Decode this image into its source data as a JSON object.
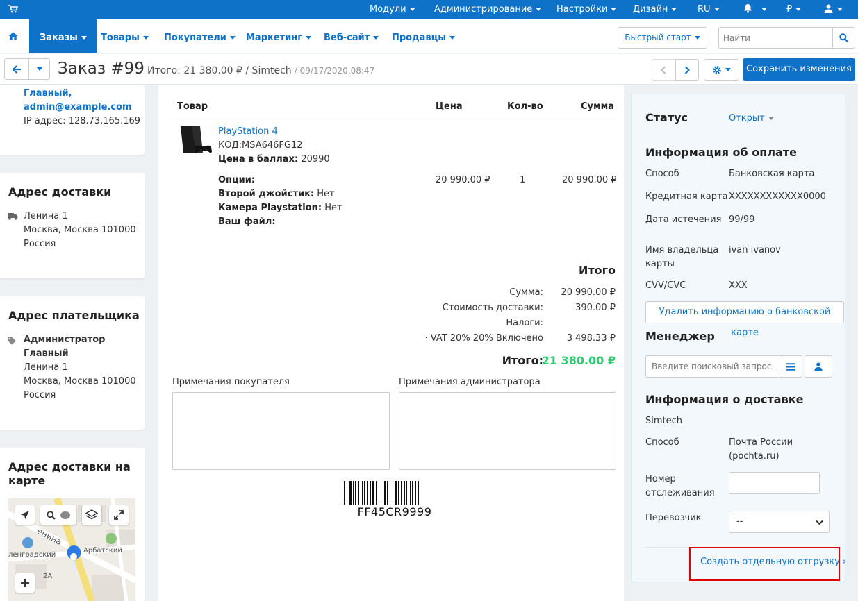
{
  "topbar": {
    "menu": [
      {
        "label": "Модули"
      },
      {
        "label": "Администрирование"
      },
      {
        "label": "Настройки"
      },
      {
        "label": "Дизайн"
      },
      {
        "label": "RU"
      },
      {
        "label": "₽"
      }
    ]
  },
  "nav": {
    "items": [
      {
        "label": "Заказы"
      },
      {
        "label": "Товары"
      },
      {
        "label": "Покупатели"
      },
      {
        "label": "Маркетинг"
      },
      {
        "label": "Веб-сайт"
      },
      {
        "label": "Продавцы"
      }
    ],
    "quick_start": "Быстрый старт",
    "search_placeholder": "Найти"
  },
  "header": {
    "title": "Заказ #99",
    "total": "Итого: 21 380.00 ₽ / Simtech",
    "date": "/ 09/17/2020,08:47",
    "save_label": "Сохранить изменения"
  },
  "customer": {
    "name_line": "Главный,",
    "email": "admin@example.com",
    "ip": "IP адрес: 128.73.165.169"
  },
  "shipping_address": {
    "title": "Адрес доставки",
    "street": "Ленина 1",
    "city": "Москва, Москва 101000",
    "country": "Россия"
  },
  "billing_address": {
    "title": "Адрес плательщика",
    "name1": "Администратор",
    "name2": "Главный",
    "street": "Ленина 1",
    "city": "Москва, Москва 101000",
    "country": "Россия"
  },
  "map": {
    "title": "Адрес доставки на карте",
    "labels": [
      "енина",
      "ленградский",
      "Арбатский",
      "2А"
    ]
  },
  "products": {
    "headers": {
      "product": "Товар",
      "price": "Цена",
      "qty": "Кол-во",
      "total": "Сумма"
    },
    "item": {
      "name": "PlayStation 4",
      "code": "КОД:MSA646FG12",
      "points_label": "Цена в баллах:",
      "points": "20990",
      "options_label": "Опции:",
      "opt1_label": "Второй джойстик:",
      "opt1_value": "Нет",
      "opt2_label": "Камера Playstation:",
      "opt2_value": "Нет",
      "opt3_label": "Ваш файл:",
      "price": "20 990.00 ₽",
      "qty": "1",
      "total": "20 990.00 ₽"
    }
  },
  "totals": {
    "title": "Итого",
    "rows": [
      {
        "label": "Сумма:",
        "value": "20 990.00 ₽"
      },
      {
        "label": "Стоимость доставки:",
        "value": "390.00 ₽"
      },
      {
        "label": "Налоги:",
        "value": ""
      },
      {
        "label": "· VAT 20% 20% Включено",
        "value": "3 498.33 ₽"
      }
    ],
    "grand_label": "Итого:",
    "grand_value": "21 380.00 ₽"
  },
  "notes": {
    "customer_label": "Примечания покупателя",
    "admin_label": "Примечания администратора"
  },
  "barcode": {
    "text": "FF45CR9999"
  },
  "status": {
    "title": "Статус",
    "value": "Открыт"
  },
  "payment": {
    "title": "Информация об оплате",
    "rows": [
      {
        "label": "Способ",
        "value": "Банковская карта"
      },
      {
        "label": "Кредитная карта",
        "value": "XXXXXXXXXXXX0000"
      },
      {
        "label": "Дата истечения",
        "value": "99/99"
      },
      {
        "label": "Имя владельца карты",
        "value": "ivan ivanov"
      },
      {
        "label": "CVV/CVC",
        "value": "XXX"
      }
    ],
    "delete_button": "Удалить информацию о банковской карте"
  },
  "manager": {
    "title": "Менеджер",
    "search_placeholder": "Введите поисковый запрос..."
  },
  "delivery": {
    "title": "Информация о доставке",
    "company": "Simtech",
    "method_label": "Способ",
    "method_value": "Почта России (pochta.ru)",
    "tracking_label": "Номер отслеживания",
    "carrier_label": "Перевозчик",
    "carrier_value": "--",
    "create_shipment": "Создать отдельную отгрузку"
  },
  "colors": {
    "accent": "#0d72c8",
    "grand_total": "#2ecc71",
    "highlight": "#e00000"
  }
}
